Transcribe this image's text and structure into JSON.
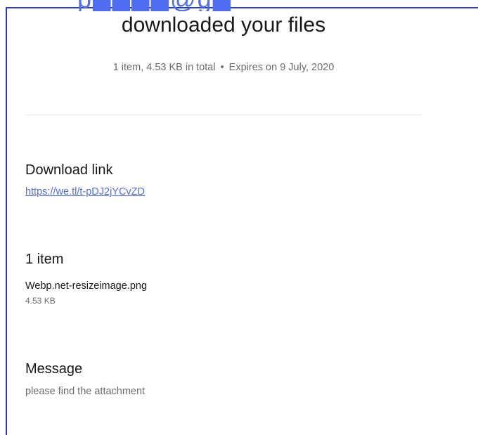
{
  "header": {
    "title": "downloaded your files",
    "summary": "1 item, 4.53 KB in total",
    "separator": "•",
    "expiry": "Expires on 9 July, 2020"
  },
  "download": {
    "heading": "Download link",
    "url": "https://we.tl/t-pDJ2jYCvZD"
  },
  "items": {
    "heading": "1 item",
    "files": [
      {
        "name": "Webp.net-resizeimage.png",
        "size": "4.53 KB"
      }
    ]
  },
  "message": {
    "heading": "Message",
    "text": "please find the attachment"
  },
  "colors": {
    "accent": "#4f6df0",
    "frame": "#2b3fb0",
    "muted_text": "#6a6d70"
  }
}
